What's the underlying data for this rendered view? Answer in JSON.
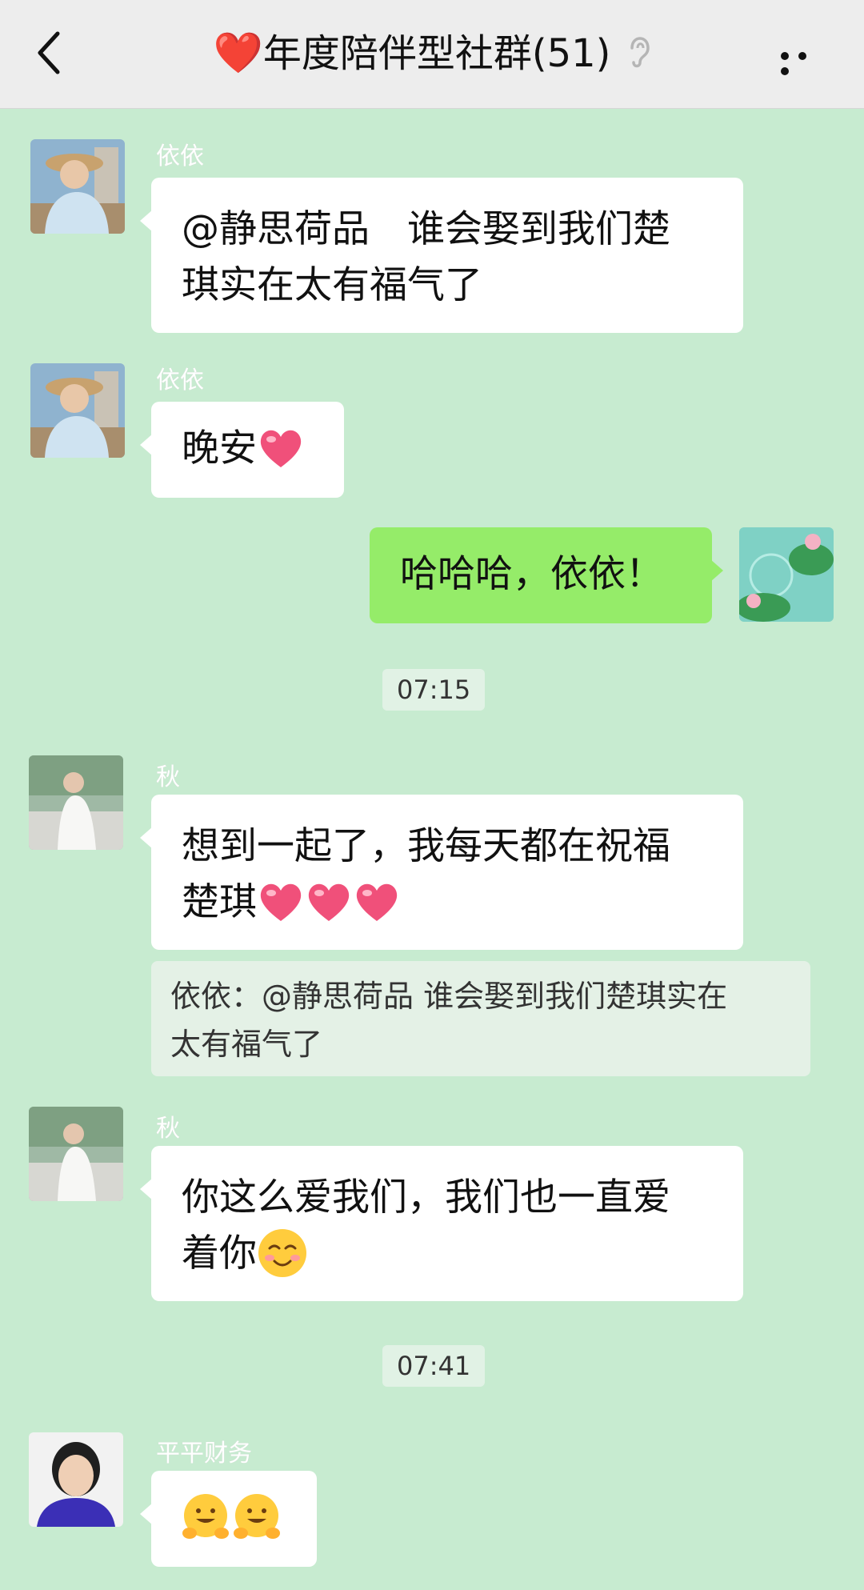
{
  "header": {
    "title_prefix_emoji": "❤️",
    "title": "年度陪伴型社群(51)",
    "back_icon": "chevron-left-icon",
    "earpiece_icon": "ear-icon",
    "more_icon": "more-dots-icon"
  },
  "messages": [
    {
      "sender": "依依",
      "text_lines": [
        "@静思荷品　谁会娶到我们楚",
        "琪实在太有福气了"
      ]
    },
    {
      "sender": "依依",
      "text": "晚安",
      "emoji": "heart"
    },
    {
      "sender": "me",
      "text": "哈哈哈，依依！"
    },
    {
      "time": "07:15"
    },
    {
      "sender": "秋",
      "text_lines": [
        "想到一起了，我每天都在祝福",
        "楚琪"
      ],
      "emoji": "heart x3",
      "quote_lines": [
        "依依：@静思荷品 谁会娶到我们楚琪实在",
        "太有福气了"
      ]
    },
    {
      "sender": "秋",
      "text_lines": [
        "你这么爱我们，我们也一直爱",
        "着你"
      ],
      "emoji": "smile"
    },
    {
      "time": "07:41"
    },
    {
      "sender": "平平财务",
      "emoji": "hugging x2"
    }
  ],
  "colors": {
    "background": "#c7ebd0",
    "header": "#ededed",
    "bubble_other": "#ffffff",
    "bubble_me": "#95ec69",
    "heart": "#f0507a"
  }
}
